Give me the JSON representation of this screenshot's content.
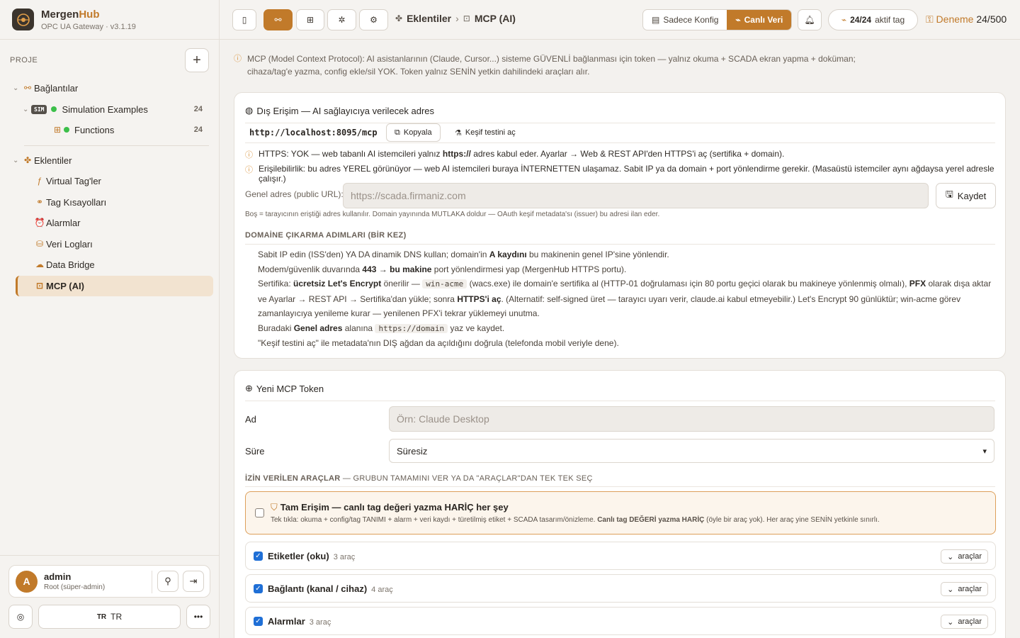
{
  "app": {
    "name_part1": "Mergen",
    "name_part2": "Hub",
    "subtitle": "OPC UA Gateway · v3.1.19"
  },
  "sidebar": {
    "project_label": "PROJE",
    "connections": {
      "label": "Bağlantılar"
    },
    "simulation": {
      "badge": "SIM",
      "label": "Simulation Examples",
      "count": "24"
    },
    "functions": {
      "label": "Functions",
      "count": "24"
    },
    "plugins": {
      "label": "Eklentiler"
    },
    "items": [
      {
        "label": "Virtual Tag'ler"
      },
      {
        "label": "Tag Kısayolları"
      },
      {
        "label": "Alarmlar"
      },
      {
        "label": "Veri Logları"
      },
      {
        "label": "Data Bridge"
      },
      {
        "label": "MCP (AI)"
      }
    ],
    "user": {
      "initial": "A",
      "name": "admin",
      "role": "Root (süper-admin)"
    },
    "language": {
      "flag": "TR",
      "label": "TR"
    }
  },
  "header": {
    "breadcrumb_parent": "Eklentiler",
    "breadcrumb_current": "MCP (AI)",
    "mode_config": "Sadece Konfig",
    "mode_live": "Canlı Veri",
    "tags_active": "24/24",
    "tags_label": "aktif tag",
    "trial_label": "Deneme",
    "trial_count": "24/500"
  },
  "notice": "MCP (Model Context Protocol): AI asistanlarının (Claude, Cursor...) sisteme GÜVENLİ bağlanması için token — yalnız okuma + SCADA ekran yapma + doküman; cihaza/tag'e yazma, config ekle/sil YOK. Token yalnız SENİN yetkin dahilindeki araçları alır.",
  "external": {
    "title": "Dış Erişim — AI sağlayıcıya verilecek adres",
    "url": "http://localhost:8095/mcp",
    "copy": "Kopyala",
    "discovery": "Keşif testini aç",
    "warn1_a": "HTTPS: YOK — web tabanlı AI istemcileri yalnız ",
    "warn1_b": "https://",
    "warn1_c": " adres kabul eder. Ayarlar → Web & REST API'den HTTPS'i aç (sertifika + domain).",
    "warn2": "Erişilebilirlik: bu adres YEREL görünüyor — web AI istemcileri buraya İNTERNETTEN ulaşamaz. Sabit IP ya da domain + port yönlendirme gerekir. (Masaüstü istemciler aynı ağdaysa yerel adresle çalışır.)",
    "public_label": "Genel adres (public URL):",
    "public_placeholder": "https://scada.firmaniz.com",
    "save": "Kaydet",
    "hint": "Boş = tarayıcının eriştiği adres kullanılır. Domain yayınında MUTLAKA doldur — OAuth keşif metadata'sı (issuer) bu adresi ilan eder.",
    "steps_title": "DOMAİNE ÇIKARMA ADIMLARI (BİR KEZ)",
    "steps": {
      "s1_a": "Sabit IP edin (ISS'den) YA DA dinamik DNS kullan; domain'in ",
      "s1_b": "A kaydını",
      "s1_c": " bu makinenin genel IP'sine yönlendir.",
      "s2_a": "Modem/güvenlik duvarında ",
      "s2_b": "443 → bu makine",
      "s2_c": " port yönlendirmesi yap (MergenHub HTTPS portu).",
      "s3_a": "Sertifika: ",
      "s3_b": "ücretsiz Let's Encrypt",
      "s3_c": " önerilir — ",
      "s3_code": "win-acme",
      "s3_d": " (wacs.exe) ile domain'e sertifika al (HTTP-01 doğrulaması için 80 portu geçici olarak bu makineye yönlenmiş olmalı), ",
      "s3_e": "PFX",
      "s3_f": " olarak dışa aktar ve Ayarlar → REST API → Sertifika'dan yükle; sonra ",
      "s3_g": "HTTPS'i aç",
      "s3_h": ". (Alternatif: self-signed üret — tarayıcı uyarı verir, claude.ai kabul etmeyebilir.) Let's Encrypt 90 günlüktür; win-acme görev zamanlayıcıya yenileme kurar — yenilenen PFX'i tekrar yüklemeyi unutma.",
      "s4_a": "Buradaki ",
      "s4_b": "Genel adres",
      "s4_c": " alanına ",
      "s4_code": "https://domain",
      "s4_d": " yaz ve kaydet.",
      "s5": "\"Keşif testini aç\" ile metadata'nın DIŞ ağdan da açıldığını doğrula (telefonda mobil veriyle dene)."
    }
  },
  "new_token": {
    "title": "Yeni MCP Token",
    "name_label": "Ad",
    "name_placeholder": "Örn: Claude Desktop",
    "duration_label": "Süre",
    "duration_value": "Süresiz",
    "tools_heading": "İZİN VERİLEN ARAÇLAR",
    "tools_heading_rest": " — GRUBUN TAMAMINI VER YA DA \"ARAÇLAR\"DAN TEK TEK SEÇ",
    "full_access_title": "Tam Erişim — canlı tag değeri yazma HARİÇ her şey",
    "full_access_desc_a": "Tek tıkla: okuma + config/tag TANIMI + alarm + veri kaydı + türetilmiş etiket + SCADA tasarım/önizleme. ",
    "full_access_desc_b": "Canlı tag DEĞERİ yazma HARİÇ",
    "full_access_desc_c": " (öyle bir araç yok). Her araç yine SENİN yetkinle sınırlı.",
    "groups": [
      {
        "name": "Etiketler (oku)",
        "count": "3 araç",
        "btn": "araçlar"
      },
      {
        "name": "Bağlantı (kanal / cihaz)",
        "count": "4 araç",
        "btn": "araçlar"
      },
      {
        "name": "Alarmlar",
        "count": "3 araç",
        "btn": "araçlar"
      }
    ]
  },
  "colors": {
    "accent": "#c17a2a",
    "checkbox": "#1f6fd6",
    "status_ok": "#3cbf4a"
  }
}
